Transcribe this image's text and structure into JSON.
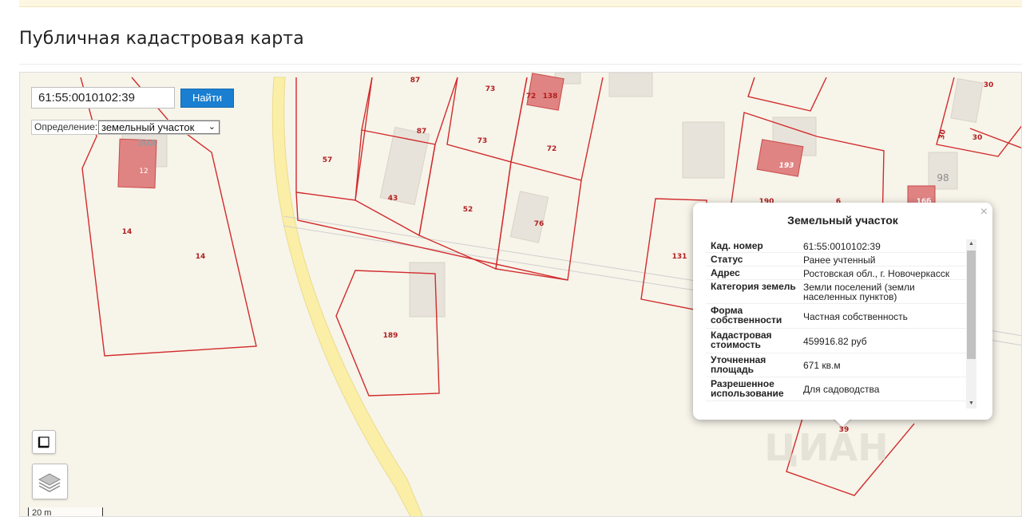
{
  "page": {
    "title": "Публичная кадастровая карта"
  },
  "search": {
    "value": "61:55:0010102:39",
    "button_label": "Найти"
  },
  "definition": {
    "label": "Определение:",
    "selected": "земельный участок"
  },
  "scale": {
    "label": "20 m"
  },
  "parcel_labels": [
    "87",
    "73",
    "72",
    "138",
    "87",
    "73",
    "72",
    "57",
    "43",
    "52",
    "76",
    "12",
    "30А",
    "14",
    "14",
    "189",
    "131",
    "193",
    "190",
    "6",
    "98",
    "30",
    "30",
    "30",
    "39",
    "16б"
  ],
  "popup": {
    "title": "Земельный участок",
    "close_symbol": "×",
    "rows": [
      {
        "key": "Кад. номер",
        "value": "61:55:0010102:39"
      },
      {
        "key": "Статус",
        "value": "Ранее учтенный"
      },
      {
        "key": "Адрес",
        "value": "Ростовская обл., г. Новочеркасск"
      },
      {
        "key": "Категория земель",
        "value": "Земли поселений (земли населенных пунктов)"
      },
      {
        "key": "Форма собственности",
        "value": "Частная собственность"
      },
      {
        "key": "Кадастровая стоимость",
        "value": "459916.82 руб"
      },
      {
        "key": "Уточненная площадь",
        "value": "671 кв.м"
      },
      {
        "key": "Разрешенное использование",
        "value": "Для садоводства"
      }
    ]
  },
  "watermark": "ЦИАН",
  "colors": {
    "parcel_line": "#d12b2b",
    "building_fill": "#e08383",
    "road": "#fbefa8",
    "button": "#1a7fd1"
  },
  "icons": {
    "ruler": "ruler-icon",
    "layers": "layers-icon"
  }
}
